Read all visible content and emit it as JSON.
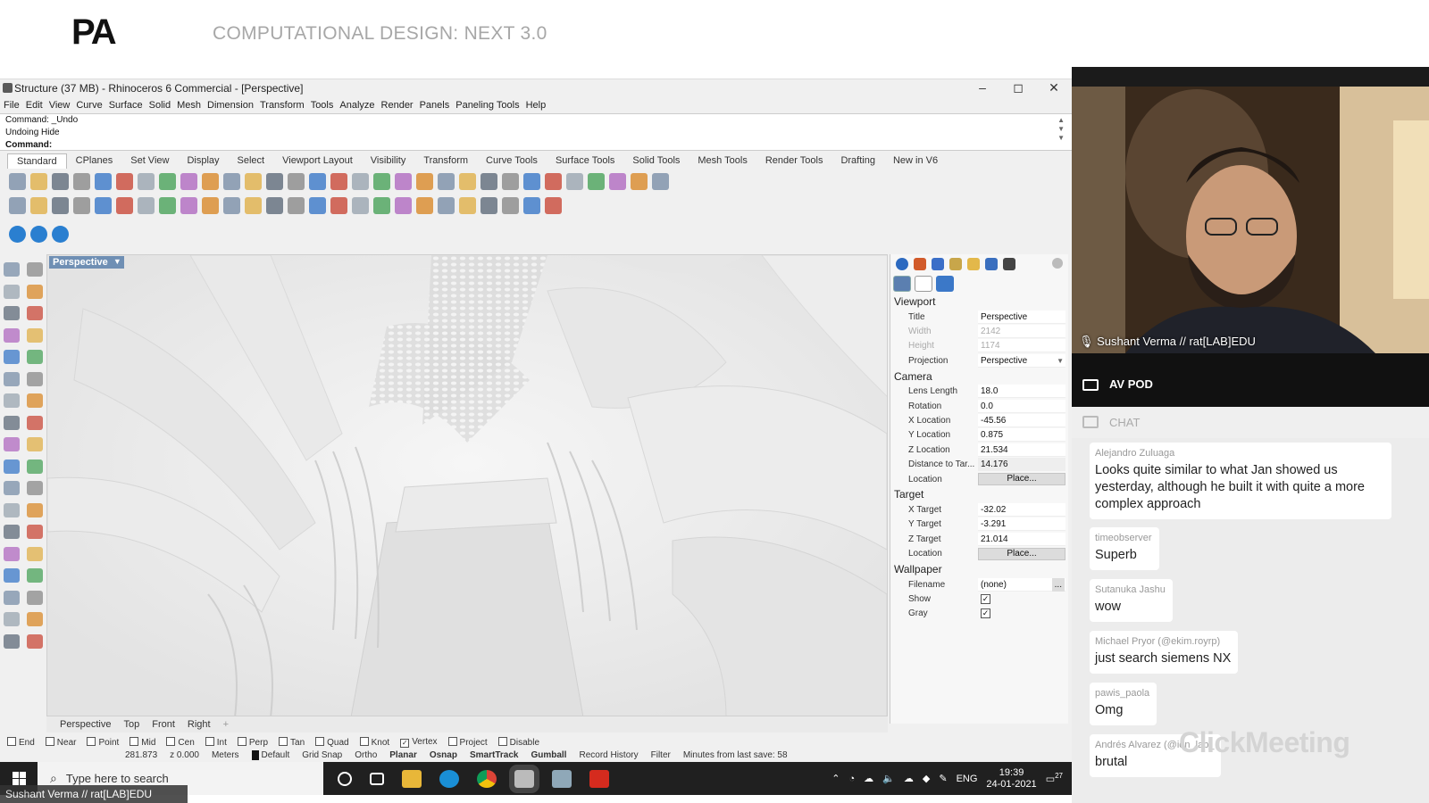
{
  "header": {
    "logo": "PA",
    "course_title": "COMPUTATIONAL DESIGN: NEXT 3.0"
  },
  "rhino": {
    "window_title": "Structure (37 MB) - Rhinoceros 6 Commercial - [Perspective]",
    "window_buttons": {
      "minimize": "–",
      "maximize": "◻",
      "close": "✕"
    },
    "menu": [
      "File",
      "Edit",
      "View",
      "Curve",
      "Surface",
      "Solid",
      "Mesh",
      "Dimension",
      "Transform",
      "Tools",
      "Analyze",
      "Render",
      "Panels",
      "Paneling Tools",
      "Help"
    ],
    "command_history": [
      "Command: _Undo",
      "Undoing Hide",
      "Command:"
    ],
    "toolbar_tabs": [
      "Standard",
      "CPlanes",
      "Set View",
      "Display",
      "Select",
      "Viewport Layout",
      "Visibility",
      "Transform",
      "Curve Tools",
      "Surface Tools",
      "Solid Tools",
      "Mesh Tools",
      "Render Tools",
      "Drafting",
      "New in V6"
    ],
    "viewport_label": "Perspective",
    "viewport_tabs": [
      "Perspective",
      "Top",
      "Front",
      "Right"
    ],
    "osnaps": [
      {
        "label": "End",
        "checked": false
      },
      {
        "label": "Near",
        "checked": false
      },
      {
        "label": "Point",
        "checked": false
      },
      {
        "label": "Mid",
        "checked": false
      },
      {
        "label": "Cen",
        "checked": false
      },
      {
        "label": "Int",
        "checked": false
      },
      {
        "label": "Perp",
        "checked": false
      },
      {
        "label": "Tan",
        "checked": false
      },
      {
        "label": "Quad",
        "checked": false
      },
      {
        "label": "Knot",
        "checked": false
      },
      {
        "label": "Vertex",
        "checked": true
      },
      {
        "label": "Project",
        "checked": false
      },
      {
        "label": "Disable",
        "checked": false
      }
    ],
    "status": {
      "coord_y": "281.873",
      "coord_z": "z 0.000",
      "units": "Meters",
      "layer": "Default",
      "items": [
        "Grid Snap",
        "Ortho",
        "Planar",
        "Osnap",
        "SmartTrack",
        "Gumball",
        "Record History",
        "Filter",
        "Minutes from last save: 58"
      ]
    },
    "properties": {
      "viewport_section": "Viewport",
      "title_label": "Title",
      "title_value": "Perspective",
      "width_label": "Width",
      "width_value": "2142",
      "height_label": "Height",
      "height_value": "1174",
      "projection_label": "Projection",
      "projection_value": "Perspective",
      "camera_section": "Camera",
      "lens_label": "Lens Length",
      "lens_value": "18.0",
      "rotation_label": "Rotation",
      "rotation_value": "0.0",
      "xloc_label": "X Location",
      "xloc_value": "-45.56",
      "yloc_label": "Y Location",
      "yloc_value": "0.875",
      "zloc_label": "Z Location",
      "zloc_value": "21.534",
      "dist_label": "Distance to Tar...",
      "dist_value": "14.176",
      "cam_location_label": "Location",
      "cam_location_button": "Place...",
      "target_section": "Target",
      "xt_label": "X Target",
      "xt_value": "-32.02",
      "yt_label": "Y Target",
      "yt_value": "-3.291",
      "zt_label": "Z Target",
      "zt_value": "21.014",
      "tgt_location_label": "Location",
      "tgt_location_button": "Place...",
      "wallpaper_section": "Wallpaper",
      "filename_label": "Filename",
      "filename_value": "(none)",
      "filename_button": "...",
      "show_label": "Show",
      "gray_label": "Gray"
    }
  },
  "taskbar": {
    "search_placeholder": "Type here to search",
    "language": "ENG",
    "time": "19:39",
    "date": "24-01-2021",
    "notifications": "27"
  },
  "presenter_tag": "Sushant Verma // rat[LAB]EDU",
  "video": {
    "name": "Sushant Verma // rat[LAB]EDU"
  },
  "av_pod": {
    "title": "AV POD"
  },
  "chat": {
    "title": "CHAT",
    "messages": [
      {
        "author": "Alejandro Zuluaga",
        "text": "Looks quite similar to what Jan showed us yesterday, although he built it with quite a more complex approach"
      },
      {
        "author": "timeobserver",
        "text": "Superb"
      },
      {
        "author": "Sutanuka Jashu",
        "text": "wow"
      },
      {
        "author": "Michael Pryor (@ekim.royrp)",
        "text": "just search siemens NX"
      },
      {
        "author": "pawis_paola",
        "text": "Omg"
      },
      {
        "author": "Andrés Alvarez (@ion_lab_",
        "text": "brutal"
      }
    ],
    "watermark": "ClickMeeting"
  }
}
